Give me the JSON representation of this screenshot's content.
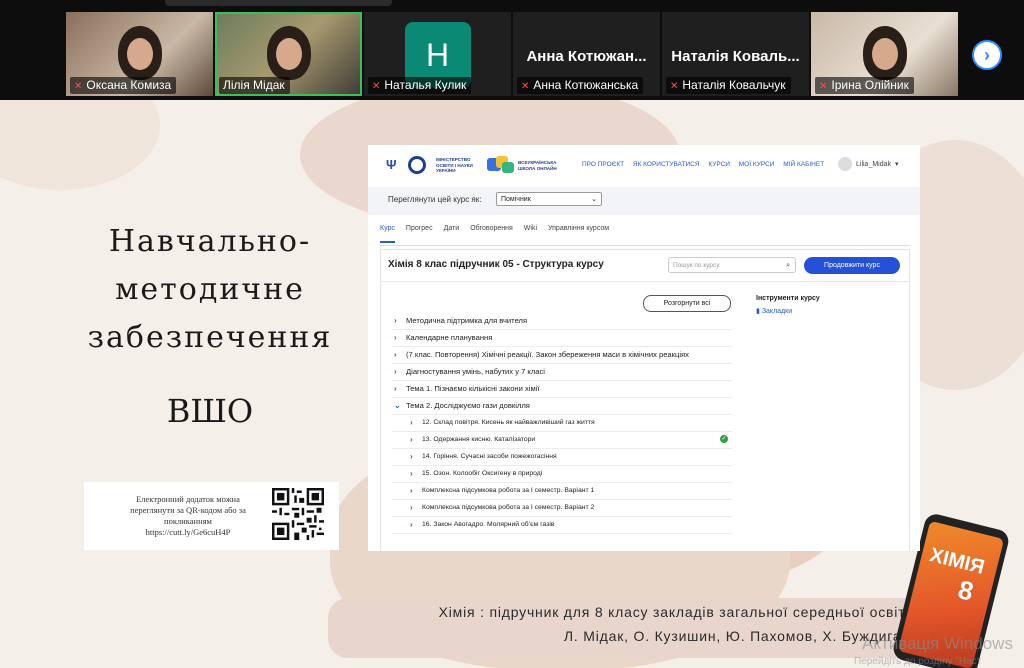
{
  "participants": [
    {
      "name": "Оксана Комиза",
      "kind": "video"
    },
    {
      "name": "Лілія Мідак",
      "kind": "video",
      "active": true
    },
    {
      "name": "Наталья Кулик",
      "kind": "avatar",
      "initial": "H",
      "avatar_color": "#0a8a74"
    },
    {
      "name": "Анна Котюжанська",
      "kind": "name",
      "display": "Анна Котюжан..."
    },
    {
      "name": "Наталія Ковальчук",
      "kind": "name",
      "display": "Наталія Коваль..."
    },
    {
      "name": "Ірина Олійник",
      "kind": "video"
    }
  ],
  "strip": {
    "next_icon": "chevron-right-icon"
  },
  "slide": {
    "title_lines": [
      "Навчально-",
      "методичне",
      "забезпечення"
    ],
    "subtitle": "ВШО",
    "qr_note": {
      "line1": "Електронний додаток можна",
      "line2": "переглянути за QR-кодом або за",
      "line3": "покликанням",
      "line4": "https://cutt.ly/Ge6cuH4P"
    },
    "caption_line1": "Хімія : підручник для 8 класу закладів загальної середньої освіти",
    "caption_line2": "Л. Мідак, О. Кузишин, Ю. Пахомов, Х. Буждиган",
    "phone_title": "ХІМІЯ",
    "phone_number": "8",
    "windows_activation_1": "Активація Windows",
    "windows_activation_2": "Перейдіть до розділу \"Наст"
  },
  "site": {
    "ministry_text": "МІНІСТЕРСТВО ОСВІТИ І НАУКИ УКРАЇНИ",
    "school_text": "ВСЕУКРАЇНСЬКА ШКОЛА ОНЛАЙН",
    "nav": [
      "ПРО ПРОЄКТ",
      "ЯК КОРИСТУВАТИСЯ",
      "КУРСИ",
      "МОЇ КУРСИ",
      "МІЙ КАБІНЕТ"
    ],
    "user": "Lilia_Midak",
    "view_label": "Переглянути цей курс як:",
    "view_value": "Помічник",
    "tabs": [
      "Курс",
      "Прогрес",
      "Дати",
      "Обговорення",
      "Wiki",
      "Управління курсом"
    ],
    "course_title": "Хімія 8 клас підручник 05 - Структура курсу",
    "search_placeholder": "Пошук по курсу",
    "continue_label": "Продовжити курс",
    "expand_label": "Розгорнути всі",
    "tools_title": "Інструменти курсу",
    "bookmarks_label": "Закладки",
    "outline": [
      {
        "label": "Методична підтримка для вчителя",
        "level": 0,
        "chev": "›"
      },
      {
        "label": "Календарне планування",
        "level": 0,
        "chev": "›"
      },
      {
        "label": "(7 клас. Повторення) Хімічні реакції. Закон збереження маси в хімічних реакціях",
        "level": 0,
        "chev": "›"
      },
      {
        "label": "Діагностування умінь, набутих у 7 класі",
        "level": 0,
        "chev": "›"
      },
      {
        "label": "Тема 1. Пізнаємо кількісні закони хімії",
        "level": 0,
        "chev": "›"
      },
      {
        "label": "Тема 2. Досліджуємо гази довкілля",
        "level": 0,
        "chev": "⌄"
      },
      {
        "label": "12. Склад повітря. Кисень як найважливіший газ життя",
        "level": 1,
        "chev": "›"
      },
      {
        "label": "13. Одержання кисню. Каталізатори",
        "level": 1,
        "chev": "›",
        "done": true
      },
      {
        "label": "14. Горіння. Сучасні засоби пожежогасіння",
        "level": 1,
        "chev": "›"
      },
      {
        "label": "15. Озон. Колообіг Оксигену в природі",
        "level": 1,
        "chev": "›"
      },
      {
        "label": "Комплексна підсумкова робота за І семестр. Варіант 1",
        "level": 1,
        "chev": "›"
      },
      {
        "label": "Комплексна підсумкова робота за І семестр. Варіант 2",
        "level": 1,
        "chev": "›"
      },
      {
        "label": "16. Закон Авогадро. Молярний об’єм газів",
        "level": 1,
        "chev": "›"
      }
    ]
  },
  "colors": {
    "accent": "#2451d8",
    "active_speaker": "#35c25a",
    "mic_off": "#ff4d4d"
  }
}
